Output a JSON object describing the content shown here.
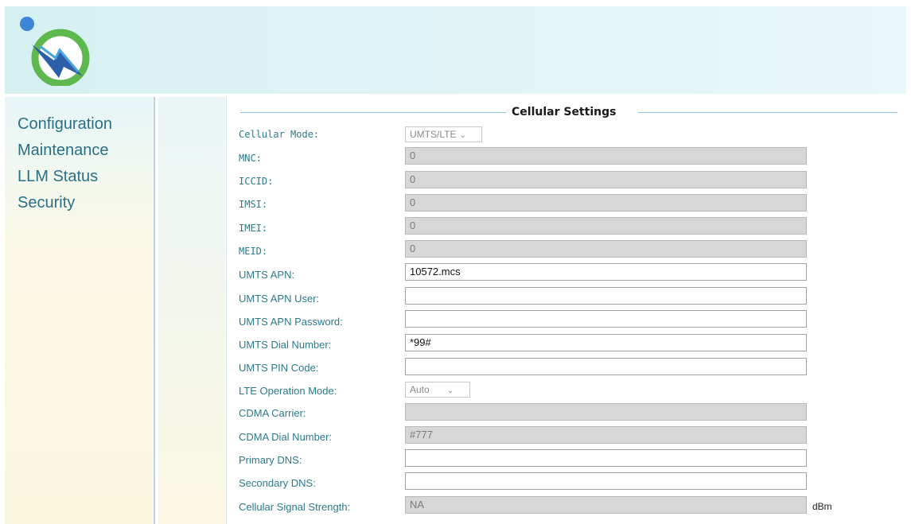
{
  "colors": {
    "label": "#2b7a8a",
    "nav": "#2a6f86",
    "header_bg": "#d6f0f2",
    "disabled_field": "#d7d7d7"
  },
  "header": {
    "logo_icon": "lightning-circle-logo-icon"
  },
  "sidebar": {
    "items": [
      {
        "label": "Configuration"
      },
      {
        "label": "Maintenance"
      },
      {
        "label": "LLM Status"
      },
      {
        "label": "Security"
      }
    ]
  },
  "section": {
    "title": "Cellular Settings"
  },
  "form": {
    "cellular_mode": {
      "label": "Cellular Mode:",
      "value": "UMTS/LTE"
    },
    "mnc": {
      "label": "MNC:",
      "value": "0"
    },
    "iccid": {
      "label": "ICCID:",
      "value": "0"
    },
    "imsi": {
      "label": "IMSI:",
      "value": "0"
    },
    "imei": {
      "label": "IMEI:",
      "value": "0"
    },
    "meid": {
      "label": "MEID:",
      "value": "0"
    },
    "umts_apn": {
      "label": "UMTS APN:",
      "value": "10572.mcs"
    },
    "umts_apn_user": {
      "label": "UMTS APN User:",
      "value": ""
    },
    "umts_apn_password": {
      "label": "UMTS APN Password:",
      "value": ""
    },
    "umts_dial_number": {
      "label": "UMTS Dial Number:",
      "value": "*99#"
    },
    "umts_pin_code": {
      "label": "UMTS PIN Code:",
      "value": ""
    },
    "lte_operation_mode": {
      "label": "LTE Operation Mode:",
      "value": "Auto"
    },
    "cdma_carrier": {
      "label": "CDMA Carrier:",
      "value": ""
    },
    "cdma_dial_number": {
      "label": "CDMA Dial Number:",
      "value": "#777"
    },
    "primary_dns": {
      "label": "Primary DNS:",
      "value": ""
    },
    "secondary_dns": {
      "label": "Secondary DNS:",
      "value": ""
    },
    "signal_strength": {
      "label": "Cellular Signal Strength:",
      "value": "NA",
      "unit": "dBm"
    }
  }
}
